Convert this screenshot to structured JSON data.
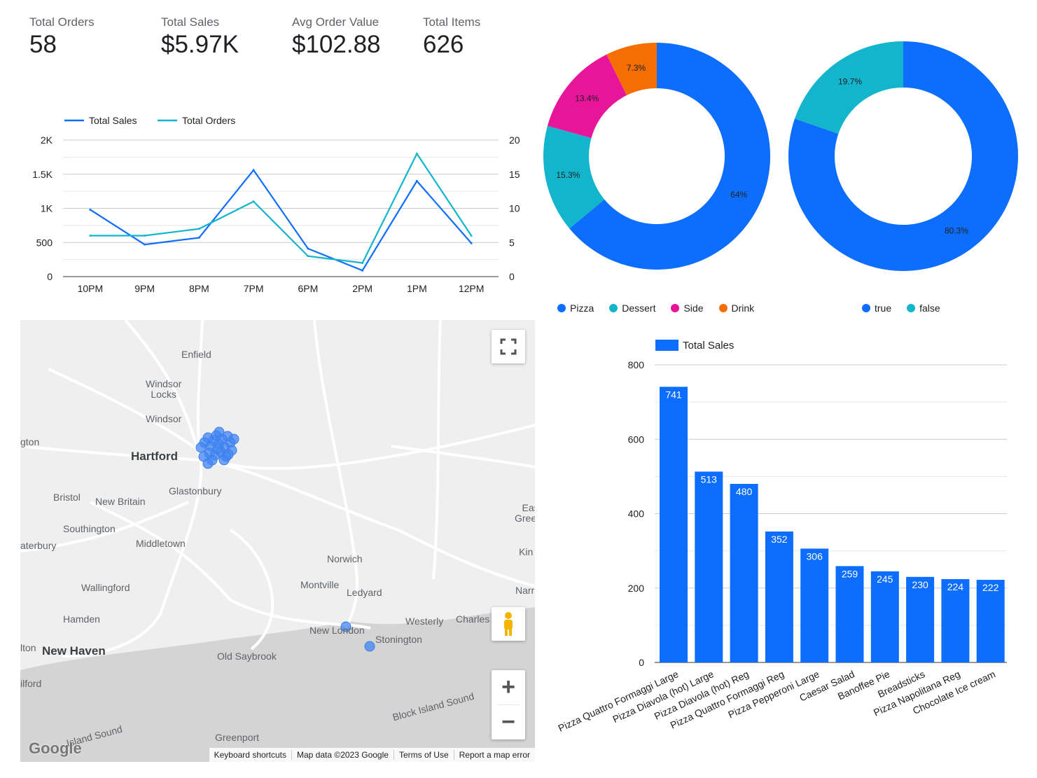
{
  "kpis": [
    {
      "label": "Total Orders",
      "value": "58"
    },
    {
      "label": "Total Sales",
      "value": "$5.97K"
    },
    {
      "label": "Avg Order Value",
      "value": "$102.88"
    },
    {
      "label": "Total Items",
      "value": "626"
    }
  ],
  "colors": {
    "blue": "#0d6efd",
    "teal": "#12b5cb",
    "pink": "#e8149a",
    "orange": "#f46e02",
    "map_dot": "#4285f4"
  },
  "chart_data": [
    {
      "type": "line",
      "categories": [
        "10PM",
        "9PM",
        "8PM",
        "7PM",
        "6PM",
        "2PM",
        "1PM",
        "12PM"
      ],
      "series": [
        {
          "name": "Total Sales",
          "axis": "left",
          "values": [
            980,
            470,
            570,
            1560,
            410,
            90,
            1400,
            490
          ]
        },
        {
          "name": "Total Orders",
          "axis": "right",
          "values": [
            6,
            6,
            7,
            11,
            3,
            2,
            18,
            6
          ]
        }
      ],
      "y_left": {
        "range": [
          0,
          2000
        ],
        "ticks": [
          "0",
          "500",
          "1K",
          "1.5K",
          "2K"
        ]
      },
      "y_right": {
        "range": [
          0,
          20
        ],
        "ticks": [
          "0",
          "5",
          "10",
          "15",
          "20"
        ]
      },
      "legend": "top-left",
      "grid": true
    },
    {
      "type": "pie",
      "donut": true,
      "slices": [
        {
          "label": "Pizza",
          "value": 64,
          "text": "64%"
        },
        {
          "label": "Dessert",
          "value": 15.3,
          "text": "15.3%"
        },
        {
          "label": "Side",
          "value": 13.4,
          "text": "13.4%"
        },
        {
          "label": "Drink",
          "value": 7.3,
          "text": "7.3%"
        }
      ],
      "legend": "bottom"
    },
    {
      "type": "pie",
      "donut": true,
      "slices": [
        {
          "label": "true",
          "value": 80.3,
          "text": "80.3%"
        },
        {
          "label": "false",
          "value": 19.7,
          "text": "19.7%"
        }
      ],
      "legend": "bottom"
    },
    {
      "type": "bar",
      "series_name": "Total Sales",
      "categories": [
        "Pizza Quattro Formaggi Large",
        "Pizza Diavola (hot) Large",
        "Pizza Diavola (hot) Reg",
        "Pizza Quattro Formaggi Reg",
        "Pizza Pepperoni Large",
        "Caesar Salad",
        "Banoffee Pie",
        "Breadsticks",
        "Pizza Napolitana Reg",
        "Chocolate Ice cream"
      ],
      "values": [
        741,
        513,
        480,
        352,
        306,
        259,
        245,
        230,
        224,
        222
      ],
      "ylim": [
        0,
        800
      ],
      "yticks": [
        "0",
        "200",
        "400",
        "600",
        "800"
      ],
      "legend": "top-left",
      "grid": true
    }
  ],
  "map": {
    "places": [
      {
        "name": "Enfield",
        "big": false
      },
      {
        "name": "Windsor\nLocks",
        "big": false
      },
      {
        "name": "Windsor",
        "big": false
      },
      {
        "name": "Hartford",
        "big": true
      },
      {
        "name": "Glastonbury",
        "big": false
      },
      {
        "name": "Bristol",
        "big": false
      },
      {
        "name": "New Britain",
        "big": false
      },
      {
        "name": "Southington",
        "big": false
      },
      {
        "name": "Middletown",
        "big": false
      },
      {
        "name": "Norwich",
        "big": false
      },
      {
        "name": "Montville",
        "big": false
      },
      {
        "name": "Ledyard",
        "big": false
      },
      {
        "name": "Wallingford",
        "big": false
      },
      {
        "name": "Hamden",
        "big": false
      },
      {
        "name": "New Haven",
        "big": true
      },
      {
        "name": "Old Saybrook",
        "big": false
      },
      {
        "name": "New London",
        "big": false
      },
      {
        "name": "Stonington",
        "big": false
      },
      {
        "name": "Westerly",
        "big": false
      },
      {
        "name": "Charles",
        "big": false
      },
      {
        "name": "Greenport",
        "big": false
      },
      {
        "name": "East\nGreenw",
        "big": false
      },
      {
        "name": "Kin",
        "big": false
      },
      {
        "name": "Narr",
        "big": false
      },
      {
        "name": "aterbury",
        "big": false
      },
      {
        "name": "lton",
        "big": false
      },
      {
        "name": "ilford",
        "big": false
      },
      {
        "name": "gton",
        "big": false
      },
      {
        "name": "Block Island Sound",
        "big": false
      },
      {
        "name": "Island Sound",
        "big": false
      }
    ],
    "attribution": [
      "Keyboard shortcuts",
      "Map data ©2023 Google",
      "Terms of Use",
      "Report a map error"
    ],
    "logo": "Google",
    "zoom_in": "+",
    "zoom_out": "−"
  }
}
